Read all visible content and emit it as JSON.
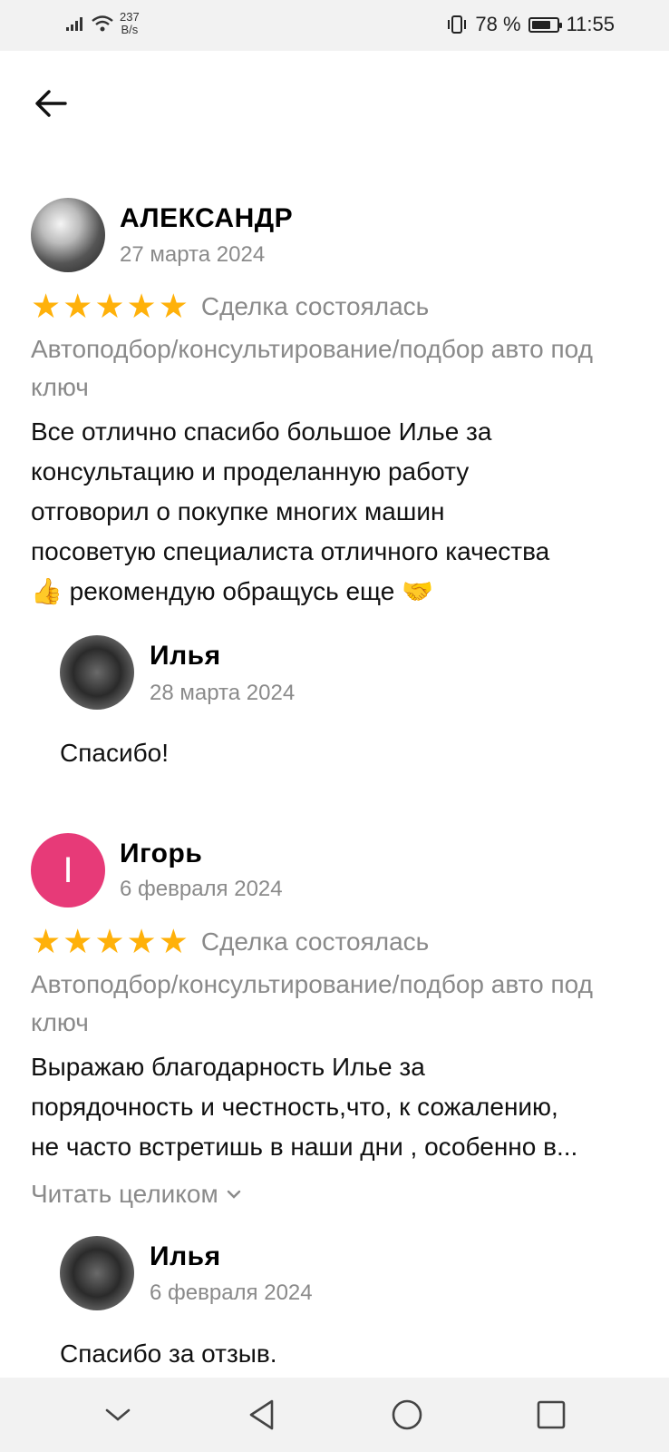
{
  "status_bar": {
    "net_speed_value": "237",
    "net_speed_unit": "B/s",
    "battery": "78 %",
    "battery_level": 0.78,
    "time": "11:55"
  },
  "reviews": [
    {
      "author": "АЛЕКСАНДР",
      "date": "27 марта 2024",
      "rating": 5,
      "deal_status": "Сделка состоялась",
      "service": "Автоподбор/консультирование/подбор авто под ключ",
      "text_lines": [
        "Все отлично спасибо большое Илье за",
        "консультацию и проделанную работу",
        "отговорил о покупке многих машин",
        "посоветую специалиста отличного качества",
        "👍 рекомендую обращусь еще 🤝"
      ],
      "reply": {
        "author": "Илья",
        "date": "28 марта 2024",
        "text": "Спасибо!"
      }
    },
    {
      "author": "Игорь",
      "avatar_letter": "I",
      "date": "6 февраля 2024",
      "rating": 5,
      "deal_status": "Сделка состоялась",
      "service": "Автоподбор/консультирование/подбор авто под ключ",
      "text_lines": [
        "Выражаю благодарность Илье за",
        "порядочность и честность,что, к сожалению,",
        "не часто встретишь в наши дни , особенно в..."
      ],
      "read_more": "Читать целиком",
      "reply": {
        "author": "Илья",
        "date": "6 февраля 2024",
        "text": "Спасибо за отзыв."
      }
    }
  ],
  "colors": {
    "star": "#ffb10a",
    "avatar_letter_bg": "#e73a78",
    "muted_text": "#8a8a8a"
  }
}
